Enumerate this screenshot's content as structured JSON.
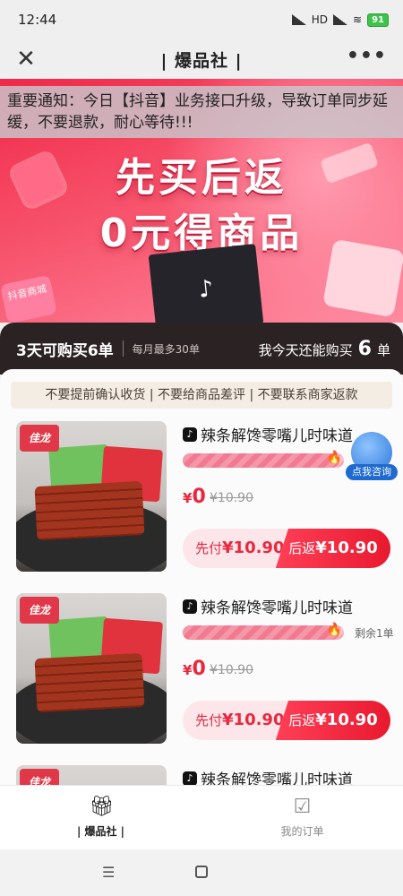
{
  "status_bar": {
    "time": "12:44",
    "battery": "91",
    "network": "HD"
  },
  "nav": {
    "title": "| 爆品社 |",
    "close_glyph": "✕",
    "more_glyph": "•••"
  },
  "notice": "重要通知：今日【抖音】业务接口升级，导致订单同步延缓，不要退款，耐心等待!!!",
  "banner": {
    "headline1": "先买后返",
    "headline2": "0元得商品",
    "tag_text": "抖音商城"
  },
  "quota": {
    "left_text": "3天可购买6单",
    "max_text": "每月最多30单",
    "right_text": "我今天还能购买",
    "right_count": "6",
    "right_unit": "单"
  },
  "rules_text": "不要提前确认收货 | 不要给商品差评 | 不要联系商家返款",
  "consult_label": "点我咨询",
  "products": [
    {
      "brand": "佳龙",
      "title": "辣条解馋零嘴儿时味道",
      "progress": 0.97,
      "remaining": "",
      "price_symbol": "¥",
      "price_now": "0",
      "price_old": "¥10.90",
      "pay_first_label": "先付",
      "pay_first_amount": "¥10.90",
      "pay_back_label": "后返",
      "pay_back_amount": "¥10.90"
    },
    {
      "brand": "佳龙",
      "title": "辣条解馋零嘴儿时味道",
      "progress": 0.97,
      "remaining": "剩余1单",
      "price_symbol": "¥",
      "price_now": "0",
      "price_old": "¥10.90",
      "pay_first_label": "先付",
      "pay_first_amount": "¥10.90",
      "pay_back_label": "后返",
      "pay_back_amount": "¥10.90"
    },
    {
      "brand": "佳龙",
      "title": "辣条解馋零嘴儿时味道"
    }
  ],
  "tabs": [
    {
      "label": "| 爆品社 |",
      "icon": "gift-icon"
    },
    {
      "label": "我的订单",
      "icon": "order-icon"
    }
  ],
  "colors": {
    "accent": "#e8283e",
    "quota_bg": "#2b2323"
  }
}
